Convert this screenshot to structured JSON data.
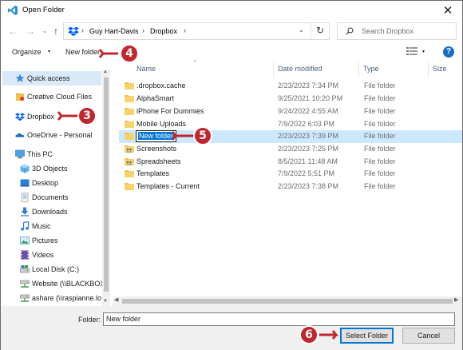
{
  "window": {
    "title": "Open Folder"
  },
  "nav": {
    "back_glyph": "←",
    "forward_glyph": "→",
    "recent_glyph": "⌄",
    "up_glyph": "↑"
  },
  "address": {
    "crumbs": [
      "Guy Hart-Davis",
      "Dropbox"
    ],
    "separator": "›",
    "dropdown": "⌄",
    "refresh": "↻"
  },
  "search": {
    "placeholder": "Search Dropbox"
  },
  "toolbar": {
    "organize": "Organize",
    "organize_caret": "▾",
    "new_folder": "New folder",
    "view_caret": "▾",
    "help": "?"
  },
  "navpane": {
    "items": [
      {
        "label": "Quick access",
        "icon": "star-icon",
        "selected": true
      },
      {
        "label": "Creative Cloud Files",
        "icon": "creative-cloud-icon"
      },
      {
        "label": "Dropbox",
        "icon": "dropbox-icon"
      },
      {
        "label": "OneDrive - Personal",
        "icon": "onedrive-icon"
      },
      {
        "label": "This PC",
        "icon": "pc-icon"
      },
      {
        "label": "3D Objects",
        "icon": "cube-icon"
      },
      {
        "label": "Desktop",
        "icon": "desktop-icon"
      },
      {
        "label": "Documents",
        "icon": "documents-icon"
      },
      {
        "label": "Downloads",
        "icon": "downloads-icon"
      },
      {
        "label": "Music",
        "icon": "music-icon"
      },
      {
        "label": "Pictures",
        "icon": "pictures-icon"
      },
      {
        "label": "Videos",
        "icon": "videos-icon"
      },
      {
        "label": "Local Disk (C:)",
        "icon": "disk-icon"
      },
      {
        "label": "Website (\\\\BLACKBOX",
        "icon": "network-drive-icon"
      },
      {
        "label": "ashare (\\\\raspianne.lo",
        "icon": "network-drive-icon"
      }
    ]
  },
  "columns": {
    "name": "Name",
    "date": "Date modified",
    "type": "Type",
    "size": "Size",
    "sort_caret": "^"
  },
  "files": [
    {
      "name": ".dropbox.cache",
      "date": "2/23/2023 7:34 PM",
      "type": "File folder",
      "icon": "folder-icon"
    },
    {
      "name": "AlphaSmart",
      "date": "9/25/2021 10:20 PM",
      "type": "File folder",
      "icon": "folder-icon"
    },
    {
      "name": "iPhone For Dummies",
      "date": "9/24/2022 4:55 AM",
      "type": "File folder",
      "icon": "folder-icon"
    },
    {
      "name": "Mobile Uploads",
      "date": "7/9/2022 6:03 PM",
      "type": "File folder",
      "icon": "folder-icon"
    },
    {
      "name": "New folder",
      "date": "2/23/2023 7:39 PM",
      "type": "File folder",
      "icon": "folder-icon",
      "selected": true
    },
    {
      "name": "Screenshots",
      "date": "2/23/2023 7:25 PM",
      "type": "File folder",
      "icon": "shared-folder-icon"
    },
    {
      "name": "Spreadsheets",
      "date": "8/5/2021 11:48 AM",
      "type": "File folder",
      "icon": "shared-folder-icon"
    },
    {
      "name": "Templates",
      "date": "7/9/2022 5:51 PM",
      "type": "File folder",
      "icon": "folder-icon"
    },
    {
      "name": "Templates - Current",
      "date": "2/23/2023 7:38 PM",
      "type": "File folder",
      "icon": "folder-icon"
    }
  ],
  "footer": {
    "folder_label": "Folder:",
    "folder_value": "New folder",
    "select_button": "Select Folder",
    "cancel_button": "Cancel"
  },
  "callouts": [
    "3",
    "4",
    "5",
    "6"
  ],
  "colors": {
    "accent": "#0078d7",
    "callout": "#c0272d",
    "selection": "#cce8ff",
    "folder": "#f2c447"
  }
}
